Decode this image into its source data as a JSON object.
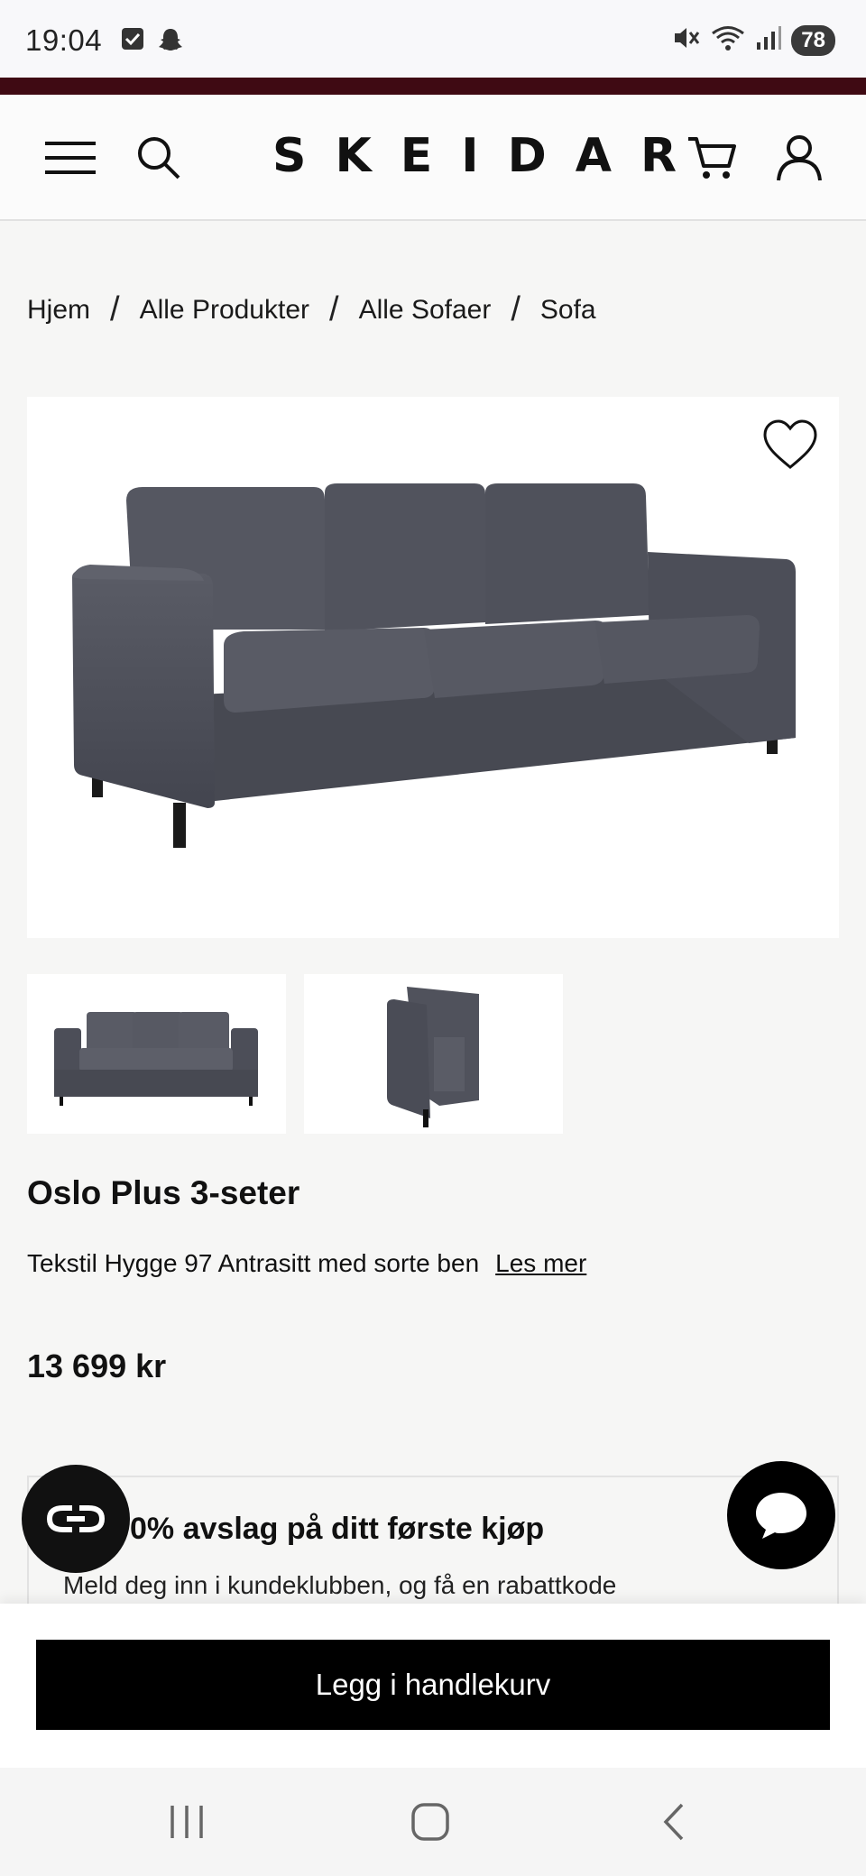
{
  "status_bar": {
    "time": "19:04",
    "battery": "78",
    "icons_left": [
      "checkbox-icon",
      "snapchat-icon"
    ],
    "icons_right": [
      "mute-icon",
      "wifi-icon",
      "signal-icon",
      "battery-icon"
    ]
  },
  "header": {
    "logo": "SKEIDAR",
    "accent_color": "#3f0a13"
  },
  "breadcrumb": {
    "items": [
      "Hjem",
      "Alle Produkter",
      "Alle Sofaer",
      "Sofa"
    ],
    "separator": "/"
  },
  "product": {
    "title": "Oslo Plus 3-seter",
    "description": "Tekstil Hygge 97 Antrasitt med sorte ben",
    "read_more": "Les mer",
    "price": "13 699 kr",
    "thumbnails": [
      "sofa-front-thumbnail",
      "sofa-side-thumbnail"
    ]
  },
  "promo": {
    "title": "0% avslag på ditt første kjøp",
    "text": "Meld deg inn i kundeklubben, og få en rabattkode"
  },
  "cart": {
    "button_label": "Legg i handlekurv"
  }
}
